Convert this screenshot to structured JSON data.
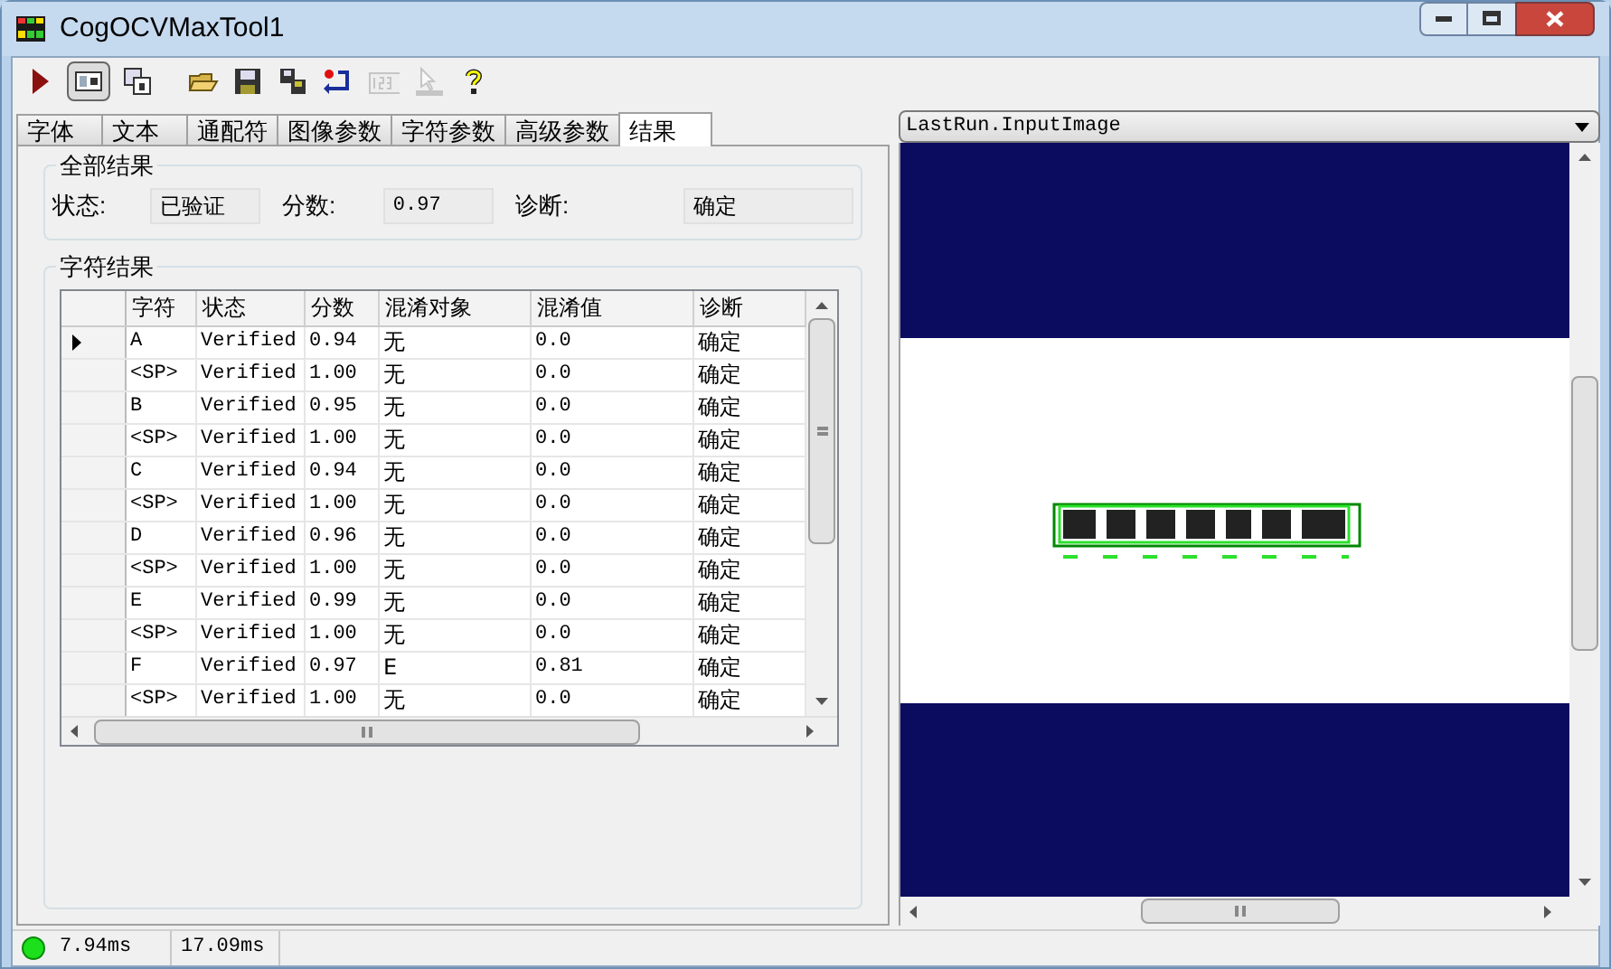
{
  "window": {
    "title": "CogOCVMaxTool1"
  },
  "toolbar": [
    {
      "kind": "run",
      "selected": false,
      "disabled": false
    },
    {
      "kind": "panel",
      "selected": true,
      "disabled": false
    },
    {
      "kind": "float",
      "selected": false,
      "disabled": false
    },
    {
      "kind": "open",
      "selected": false,
      "disabled": false
    },
    {
      "kind": "save",
      "selected": false,
      "disabled": false
    },
    {
      "kind": "saveall",
      "selected": false,
      "disabled": false
    },
    {
      "kind": "reset",
      "selected": false,
      "disabled": false
    },
    {
      "kind": "number",
      "selected": false,
      "disabled": true
    },
    {
      "kind": "pointer",
      "selected": false,
      "disabled": true
    },
    {
      "kind": "help",
      "selected": false,
      "disabled": false
    }
  ],
  "tabs": [
    {
      "label": "字体",
      "selected": false
    },
    {
      "label": "文本",
      "selected": false
    },
    {
      "label": "通配符",
      "selected": false
    },
    {
      "label": "图像参数",
      "selected": false
    },
    {
      "label": "字符参数",
      "selected": false
    },
    {
      "label": "高级参数",
      "selected": false
    },
    {
      "label": "结果",
      "selected": true
    }
  ],
  "overall": {
    "title": "全部结果",
    "fields": [
      {
        "label": "状态:",
        "value": "已验证"
      },
      {
        "label": "分数:",
        "value": "0.97"
      },
      {
        "label": "诊断:",
        "value": "确定"
      }
    ]
  },
  "char_results": {
    "title": "字符结果",
    "table": {
      "columns": [
        "字符",
        "状态",
        "分数",
        "混淆对象",
        "混淆值",
        "诊断"
      ],
      "rows": [
        {
          "selected": true,
          "cells": [
            "A",
            "Verified",
            "0.94",
            "无",
            "0.0",
            "确定"
          ]
        },
        {
          "selected": false,
          "cells": [
            "<SP>",
            "Verified",
            "1.00",
            "无",
            "0.0",
            "确定"
          ]
        },
        {
          "selected": false,
          "cells": [
            "B",
            "Verified",
            "0.95",
            "无",
            "0.0",
            "确定"
          ]
        },
        {
          "selected": false,
          "cells": [
            "<SP>",
            "Verified",
            "1.00",
            "无",
            "0.0",
            "确定"
          ]
        },
        {
          "selected": false,
          "cells": [
            "C",
            "Verified",
            "0.94",
            "无",
            "0.0",
            "确定"
          ]
        },
        {
          "selected": false,
          "cells": [
            "<SP>",
            "Verified",
            "1.00",
            "无",
            "0.0",
            "确定"
          ]
        },
        {
          "selected": false,
          "cells": [
            "D",
            "Verified",
            "0.96",
            "无",
            "0.0",
            "确定"
          ]
        },
        {
          "selected": false,
          "cells": [
            "<SP>",
            "Verified",
            "1.00",
            "无",
            "0.0",
            "确定"
          ]
        },
        {
          "selected": false,
          "cells": [
            "E",
            "Verified",
            "0.99",
            "无",
            "0.0",
            "确定"
          ]
        },
        {
          "selected": false,
          "cells": [
            "<SP>",
            "Verified",
            "1.00",
            "无",
            "0.0",
            "确定"
          ]
        },
        {
          "selected": false,
          "cells": [
            "F",
            "Verified",
            "0.97",
            "E",
            "0.81",
            "确定"
          ]
        },
        {
          "selected": false,
          "cells": [
            "<SP>",
            "Verified",
            "1.00",
            "无",
            "0.0",
            "确定"
          ]
        }
      ]
    }
  },
  "image_view": {
    "source": "LastRun.InputImage"
  },
  "status_bar": {
    "items": [
      "7.94ms",
      "17.09ms"
    ]
  }
}
